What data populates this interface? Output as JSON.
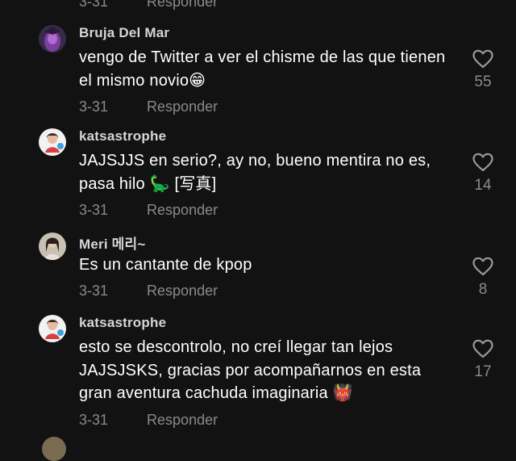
{
  "top": {
    "date": "3-31",
    "reply": "Responder"
  },
  "comments": [
    {
      "username": "Bruja Del Mar",
      "text": "vengo de Twitter a ver el chisme de las que tienen el mismo novio😁",
      "date": "3-31",
      "reply": "Responder",
      "likes": "55"
    },
    {
      "username": "katsastrophe",
      "text": "JAJSJJS en serio?, ay no, bueno mentira no es, pasa hilo 🦕 [写真]",
      "date": "3-31",
      "reply": "Responder",
      "likes": "14"
    },
    {
      "username": "Meri 메리~",
      "text": "Es un cantante de kpop",
      "date": "3-31",
      "reply": "Responder",
      "likes": "8"
    },
    {
      "username": "katsastrophe",
      "text": "esto se descontrolo, no creí llegar tan lejos JAJSJSKS, gracias por acompañarnos en esta gran aventura cachuda imaginaria 👹",
      "date": "3-31",
      "reply": "Responder",
      "likes": "17"
    }
  ],
  "colors": {
    "background": "#121212",
    "muted": "#8a8a8a",
    "text": "#ffffff"
  },
  "icons": {
    "like": "heart-outline-icon"
  }
}
